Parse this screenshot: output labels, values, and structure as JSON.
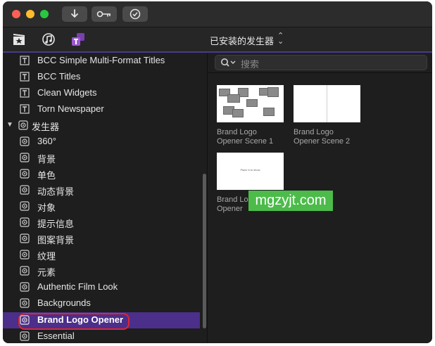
{
  "window": {
    "title_controls": {
      "close_color": "#fe5f57",
      "minimize_color": "#febc2e",
      "zoom_color": "#28c840"
    },
    "toolbar_buttons": [
      {
        "icon": "download-arrow-icon"
      },
      {
        "icon": "key-icon"
      },
      {
        "icon": "checkmark-circle-icon"
      }
    ]
  },
  "browser_tabs": [
    {
      "icon": "clapper-star-icon"
    },
    {
      "icon": "music-note-icon"
    },
    {
      "icon": "titles-t-icon",
      "accent": "#9b59d0"
    }
  ],
  "header": {
    "selector_label": "已安装的发生器",
    "selector_icon": "up-down-chevron-icon"
  },
  "sidebar": {
    "items": [
      {
        "label": "BCC Simple Multi-Format Titles",
        "icon": "title-icon"
      },
      {
        "label": "BCC Titles",
        "icon": "title-icon"
      },
      {
        "label": "Clean Widgets",
        "icon": "title-icon"
      },
      {
        "label": "Torn Newspaper",
        "icon": "title-icon"
      },
      {
        "label": "发生器",
        "icon": "generator-icon",
        "group": true,
        "expanded": true
      },
      {
        "label": "360°",
        "icon": "generator-icon"
      },
      {
        "label": "背景",
        "icon": "generator-icon"
      },
      {
        "label": "单色",
        "icon": "generator-icon"
      },
      {
        "label": "动态背景",
        "icon": "generator-icon"
      },
      {
        "label": "对象",
        "icon": "generator-icon"
      },
      {
        "label": "提示信息",
        "icon": "generator-icon"
      },
      {
        "label": "图案背景",
        "icon": "generator-icon"
      },
      {
        "label": "纹理",
        "icon": "generator-icon"
      },
      {
        "label": "元素",
        "icon": "generator-icon"
      },
      {
        "label": "Authentic Film Look",
        "icon": "generator-icon"
      },
      {
        "label": "Backgrounds",
        "icon": "generator-icon"
      },
      {
        "label": "Brand Logo Opener",
        "icon": "generator-icon",
        "selected": true
      },
      {
        "label": "Essential",
        "icon": "generator-icon"
      }
    ],
    "selection_color": "#4b2f8a"
  },
  "search": {
    "placeholder": "搜索"
  },
  "thumbnails": [
    {
      "line1": "Brand Logo",
      "line2": "Opener Scene 1"
    },
    {
      "line1": "Brand Logo",
      "line2": "Opener Scene 2"
    },
    {
      "line1": "Brand Lo",
      "line2": "Opener",
      "caption": "Place it to show"
    }
  ],
  "watermark": {
    "text": "mgzyjt.com"
  }
}
